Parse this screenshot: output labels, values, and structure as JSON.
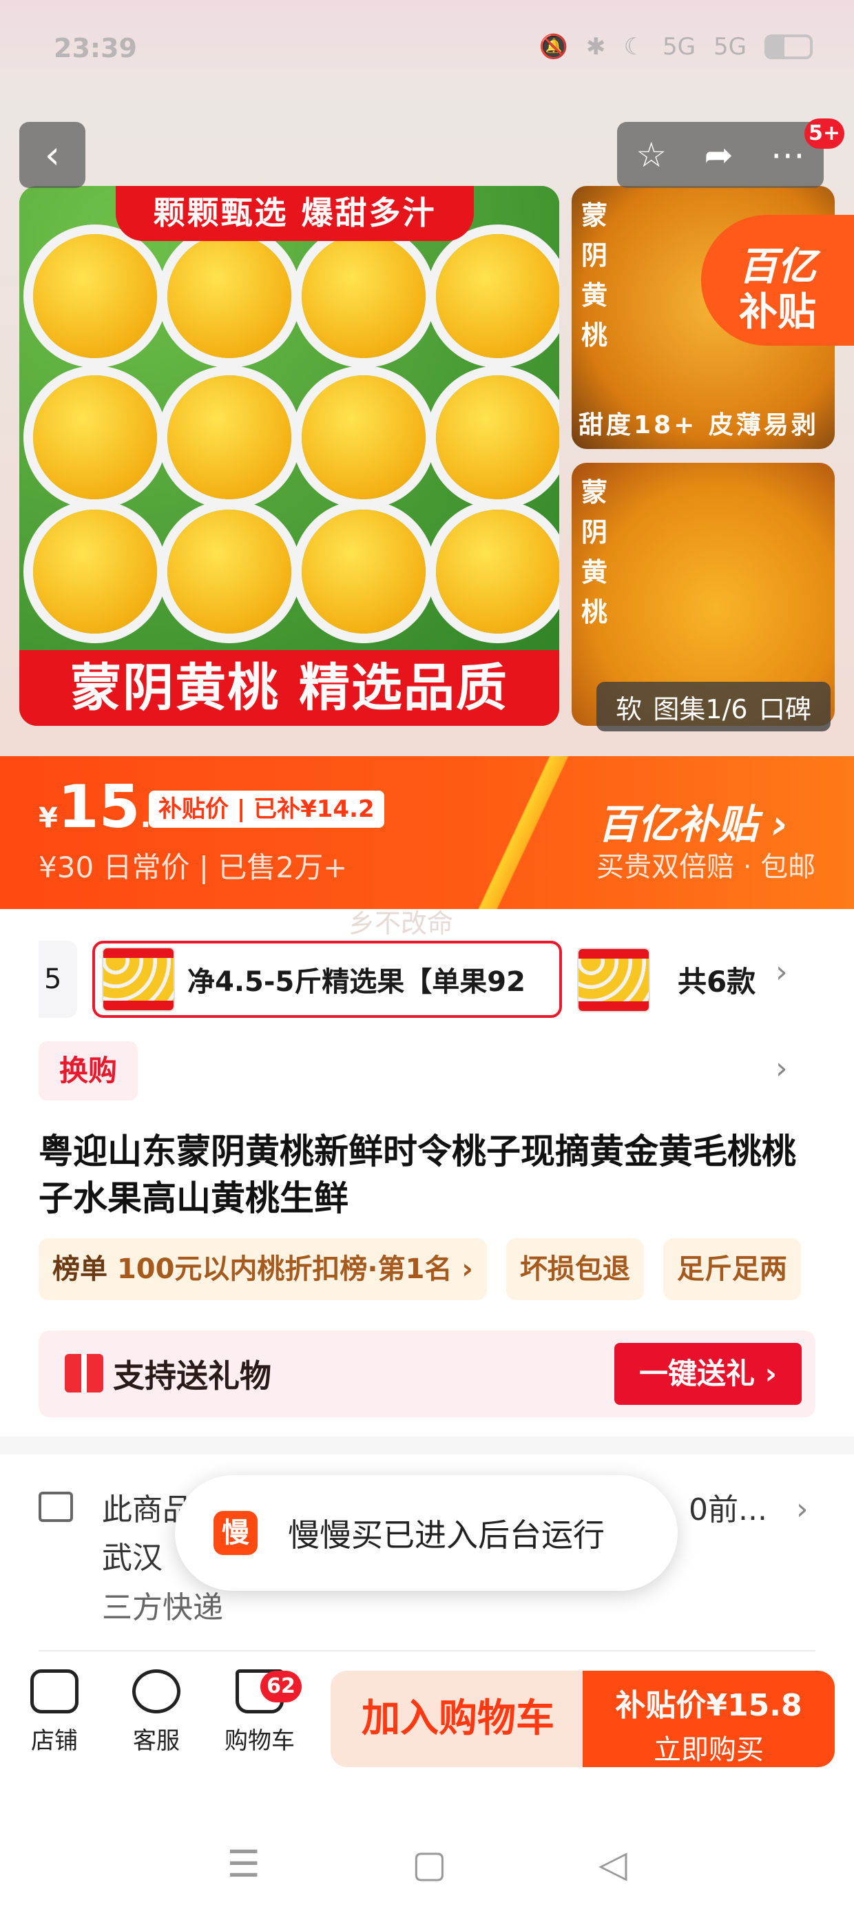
{
  "status_bar": {
    "time": "23:39",
    "icons": [
      "qq-icon",
      "mute-icon",
      "bluetooth-icon",
      "moon-icon",
      "5g-signal-icon",
      "5g-signal-icon",
      "battery-icon"
    ],
    "net1": "5G",
    "net2": "5G"
  },
  "gallery": {
    "more_badge": "5+",
    "main_banner_top": "颗颗甄选 爆甜多汁",
    "main_banner_bottom": "蒙阴黄桃 精选品质",
    "thumb1_vertical": "蒙阴黄桃",
    "thumb1_caption": "甜度18+ 皮薄易剥",
    "thumb2_vertical": "蒙阴黄桃",
    "subsidy_badge_line1": "百亿",
    "subsidy_badge_line2": "补贴",
    "counter_left": "软",
    "counter": "图集1/6",
    "counter_right": "口碑"
  },
  "price_bar": {
    "yen": "¥",
    "price_int": "15",
    "price_dec": ".8",
    "subsidy_tag": "补贴价 | 已补¥14.2",
    "daily_price": "¥30  日常价 | 已售2万+",
    "brand": "百亿补贴 ›",
    "brand_sub": "买贵双倍赔 · 包邮"
  },
  "watermark": "乡不改命",
  "sku": {
    "edge_text": "5",
    "active_text": "净4.5-5斤精选果【单果92",
    "count": "共6款"
  },
  "swap_tag": "换购",
  "title": "粤迎山东蒙阴黄桃新鲜时令桃子现摘黄金黄毛桃桃子水果高山黄桃生鲜",
  "tags": {
    "rank_key": "榜单",
    "rank_value": "100元以内桃折扣榜·第1名 ›",
    "tag2": "坏损包退",
    "tag3": "足斤足两"
  },
  "gift": {
    "label": "支持送礼物",
    "button": "一键送礼 ›"
  },
  "delivery": {
    "line1_left": "此商品",
    "line1_right": "0前...",
    "line2": "武汉",
    "line3": "三方快递"
  },
  "toast": {
    "app_icon_text": "慢",
    "message": "慢慢买已进入后台运行"
  },
  "bottom_bar": {
    "store": "店铺",
    "service": "客服",
    "cart": "购物车",
    "cart_count": "62",
    "add_cart": "加入购物车",
    "buy_line1": "补贴价¥15.8",
    "buy_line2": "立即购买"
  },
  "navbar": {
    "menu": "☰",
    "home": "▢",
    "back": "◁"
  }
}
